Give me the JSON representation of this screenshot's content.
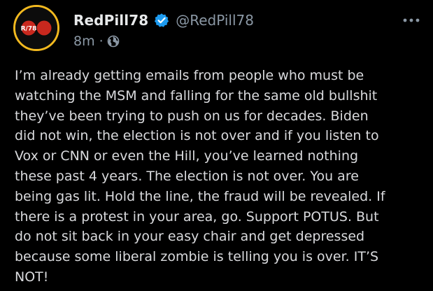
{
  "post": {
    "author": {
      "display_name": "RedPill78",
      "handle": "@RedPill78",
      "verified": true,
      "avatar_text": "R/78"
    },
    "meta": {
      "time_ago": "8m",
      "separator": "·",
      "visibility_icon": "globe-icon"
    },
    "more_icon": "ellipsis-icon",
    "body_lines": [
      "I’m already getting emails from people who must be",
      "watching the MSM and falling for the same old bullshit",
      "they’ve been trying to push on us for decades. Biden",
      "did not win, the election is not over and if you listen to",
      "Vox or CNN or even the Hill, you’ve learned nothing",
      "these past 4 years. The election is not over. You are",
      "being gas lit. Hold the line, the fraud will be revealed. If",
      "there is a protest in your area, go. Support POTUS. But",
      "do not sit back in your easy chair and get depressed",
      "because some liberal zombie is telling you is over. IT’S",
      "NOT!"
    ]
  },
  "colors": {
    "background": "#000000",
    "text": "#d9dadd",
    "muted": "#8b98a5",
    "verified": "#1d9bf0",
    "avatar_ring": "#f2b91f",
    "avatar_red": "#c8281e"
  }
}
